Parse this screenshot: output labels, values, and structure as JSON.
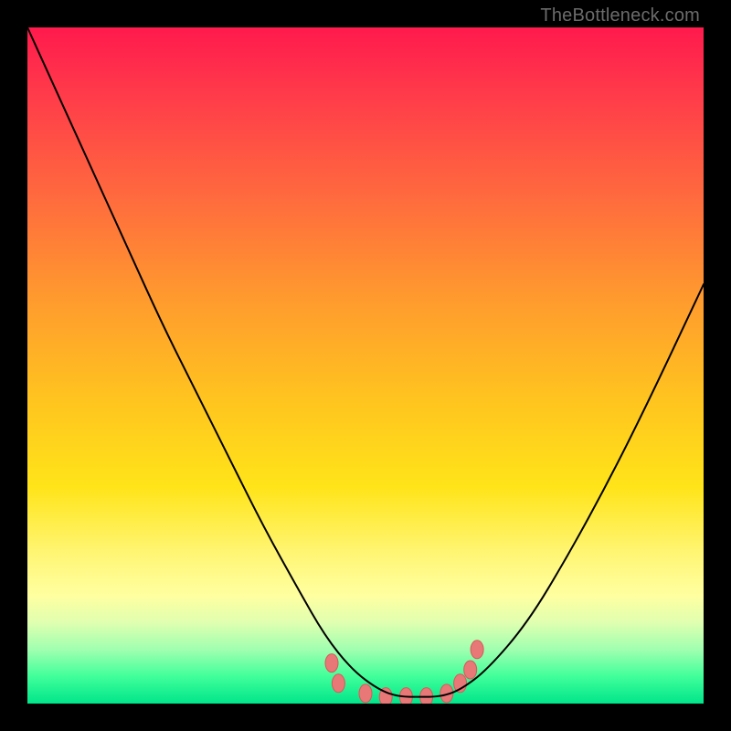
{
  "watermark": "TheBottleneck.com",
  "chart_data": {
    "type": "line",
    "title": "",
    "xlabel": "",
    "ylabel": "",
    "xlim": [
      0,
      100
    ],
    "ylim": [
      0,
      100
    ],
    "grid": false,
    "legend": false,
    "series": [
      {
        "name": "bottleneck-curve",
        "x": [
          0,
          5,
          10,
          15,
          20,
          25,
          30,
          35,
          40,
          44,
          48,
          52,
          55,
          58,
          61,
          64,
          68,
          74,
          80,
          86,
          92,
          100
        ],
        "y": [
          100,
          89,
          78,
          67,
          56,
          46,
          36,
          26,
          17,
          10,
          5,
          2,
          1,
          1,
          1,
          2,
          5,
          12,
          22,
          33,
          45,
          62
        ],
        "stroke": "#000000",
        "stroke_width": 2
      }
    ],
    "markers": {
      "name": "trough-markers",
      "color": "#e87878",
      "stroke": "#d85858",
      "points": [
        {
          "x": 45,
          "y": 6
        },
        {
          "x": 46,
          "y": 3
        },
        {
          "x": 50,
          "y": 1.5
        },
        {
          "x": 53,
          "y": 1
        },
        {
          "x": 56,
          "y": 1
        },
        {
          "x": 59,
          "y": 1
        },
        {
          "x": 62,
          "y": 1.5
        },
        {
          "x": 64,
          "y": 3
        },
        {
          "x": 65.5,
          "y": 5
        },
        {
          "x": 66.5,
          "y": 8
        }
      ],
      "rx": 7,
      "ry": 10
    },
    "background_gradient": {
      "top": "#ff1a4d",
      "mid": "#ffe419",
      "bottom": "#00e58a"
    }
  }
}
